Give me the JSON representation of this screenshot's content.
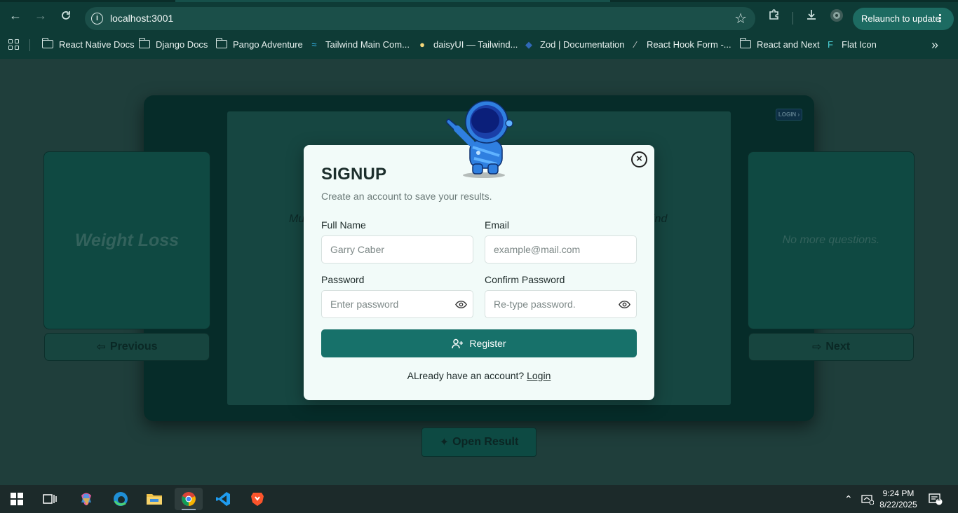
{
  "browser": {
    "url": "localhost:3001",
    "relaunch_label": "Relaunch to update",
    "bookmarks": [
      {
        "label": "React Native Docs",
        "icon": "folder-icon"
      },
      {
        "label": "Django Docs",
        "icon": "folder-icon"
      },
      {
        "label": "Pango Adventure",
        "icon": "folder-icon"
      },
      {
        "label": "Tailwind Main Com...",
        "icon": "tailwind-icon"
      },
      {
        "label": "daisyUI — Tailwind...",
        "icon": "daisyui-icon"
      },
      {
        "label": "Zod | Documentation",
        "icon": "zod-icon"
      },
      {
        "label": "React Hook Form -...",
        "icon": "react-hook-form-icon"
      },
      {
        "label": "React and Next",
        "icon": "folder-icon"
      },
      {
        "label": "Flat Icon",
        "icon": "flaticon-icon"
      }
    ]
  },
  "quiz": {
    "left_card_label": "Weight Loss",
    "right_card_label": "No more questions.",
    "previous_label": "Previous",
    "next_label": "Next",
    "open_result_label": "Open Result",
    "login_badge": "LOGIN",
    "behind_text_left": "Mu",
    "behind_text_right": "ind"
  },
  "modal": {
    "title": "SIGNUP",
    "subtitle": "Create an account to save your results.",
    "full_name": {
      "label": "Full Name",
      "placeholder": "Garry Caber"
    },
    "email": {
      "label": "Email",
      "placeholder": "example@mail.com"
    },
    "password": {
      "label": "Password",
      "placeholder": "Enter password"
    },
    "confirm_password": {
      "label": "Confirm Password",
      "placeholder": "Re-type password."
    },
    "register_label": "Register",
    "login_prompt": "ALready have an account?",
    "login_link": "Login"
  },
  "taskbar": {
    "time": "9:24 PM",
    "date": "8/22/2025",
    "notification_count": "1"
  },
  "colors": {
    "accent": "#17716a",
    "page_bg": "#1f3e3b",
    "modal_bg": "#f2fbf9",
    "chrome_bg": "#0e3b36"
  }
}
